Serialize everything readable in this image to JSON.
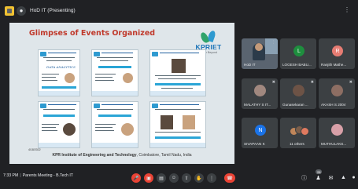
{
  "presenter_chip": {
    "name": "HoD IT (Presenting)",
    "mic_icon": "mic-icon"
  },
  "slide": {
    "title": "Glimpses of Events Organized",
    "brand": "KPRIET",
    "brand_sub": "Learn Beyond",
    "poster_tag": "DATA ANALYTICS",
    "date": "4/18/2022",
    "footer_bold": "KPR Institute of Engineering and Technology",
    "footer_rest": ", Coimbatore, Tamil Nadu, India"
  },
  "participants": [
    {
      "label": "HoD IT",
      "kind": "video"
    },
    {
      "label": "LOGESH BABU...",
      "initial": "L",
      "color": "#1e8e3e"
    },
    {
      "label": "Ranjith Mathe...",
      "initial": "R",
      "color": "#e67c73"
    },
    {
      "label": "MALATHY S IT...",
      "kind": "photo"
    },
    {
      "label": "Gunasekaran ...",
      "kind": "photo"
    },
    {
      "label": "AKASH S 2004",
      "kind": "photo"
    },
    {
      "label": "SIVAPAAN K",
      "initial": "N",
      "color": "#1a73e8"
    },
    {
      "label": "11 others",
      "kind": "others"
    },
    {
      "label": "MUTHULAKS...",
      "kind": "photo"
    }
  ],
  "bottom": {
    "time": "7:33 PM",
    "meeting": "Parents Meeting - B.Tech IT",
    "people_count": "28"
  },
  "colors": {
    "end_call": "#ea4335",
    "slide_title": "#c0392b",
    "brand": "#1a73b8"
  }
}
